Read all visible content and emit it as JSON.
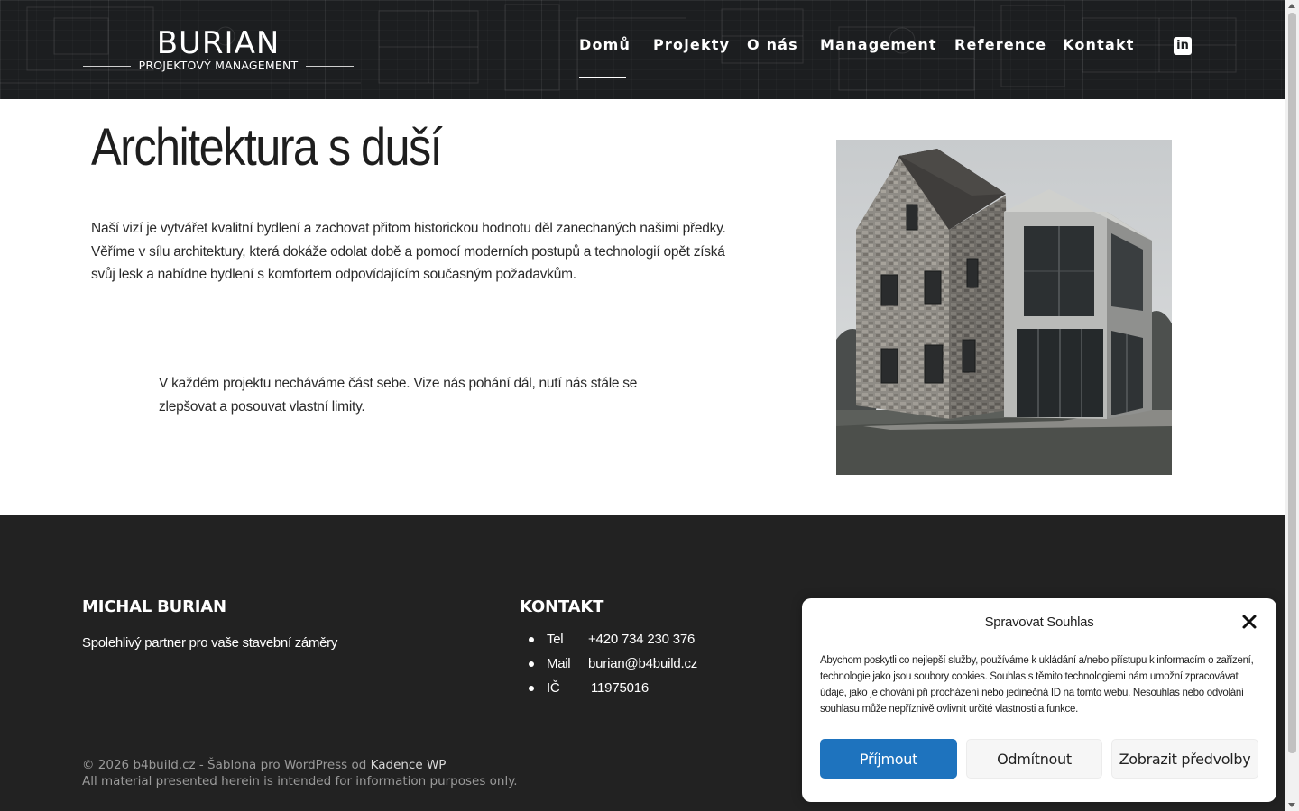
{
  "header": {
    "logo": {
      "title": "BURIAN",
      "subtitle": "PROJEKTOVÝ MANAGEMENT"
    },
    "nav": [
      {
        "label": "Domů",
        "active": true
      },
      {
        "label": "Projekty"
      },
      {
        "label": "O nás"
      },
      {
        "label": "Management"
      },
      {
        "label": "Reference"
      },
      {
        "label": "Kontakt"
      }
    ],
    "social_icon": "linkedin-icon",
    "social_glyph": "in"
  },
  "main": {
    "title": "Architektura s duší",
    "lead": "Naší vizí je vytvářet kvalitní bydlení a zachovat přitom historickou hodnotu děl zanechaných našimi předky. Věříme v sílu architektury, která dokáže odolat době a pomocí moderních postupů a technologií opět získá svůj lesk a nabídne bydlení s komfortem odpovídajícím současným požadavkům.",
    "quote": "V každém projektu necháváme část sebe. Vize nás pohání dál, nutí nás stále se zlepšovat a posouvat vlastní limity."
  },
  "footer": {
    "col1": {
      "heading": "MICHAL BURIAN",
      "tagline": "Spolehlivý partner pro vaše stavební záměry"
    },
    "col2": {
      "heading": "KONTAKT",
      "items": [
        {
          "label": "Tel",
          "value": "+420 734 230 376"
        },
        {
          "label": "Mail",
          "value": "burian@b4build.cz"
        },
        {
          "label": "IČ",
          "value": "11975016"
        }
      ]
    },
    "copyright_prefix": "© 2026 b4build.cz - Šablona pro WordPress od",
    "copyright_link": "Kadence WP",
    "disclaimer": "All material presented herein is intended for information purposes only."
  },
  "cookie": {
    "title": "Spravovat Souhlas",
    "text": "Abychom poskytli co nejlepší služby, používáme k ukládání a/nebo přístupu k informacím o zařízení, technologie jako jsou soubory cookies. Souhlas s těmito technologiemi nám umožní zpracovávat údaje, jako je chování při procházení nebo jedinečná ID na tomto webu. Nesouhlas nebo odvolání souhlasu může nepříznivě ovlivnit určité vlastnosti a funkce.",
    "accept": "Příjmout",
    "deny": "Odmítnout",
    "preferences": "Zobrazit předvolby"
  },
  "colors": {
    "header_bg": "#1c1e20",
    "footer_bg": "#222222",
    "accent": "#1e73be"
  }
}
